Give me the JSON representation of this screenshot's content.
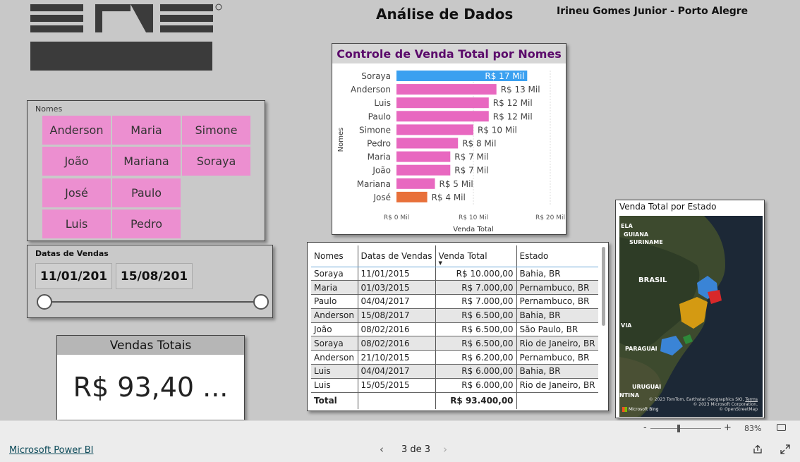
{
  "header": {
    "title": "Análise de Dados",
    "author": "Irineu Gomes Junior - Porto Alegre"
  },
  "names_slicer": {
    "label": "Nomes",
    "items": [
      "Anderson",
      "Maria",
      "Simone",
      "João",
      "Mariana",
      "Soraya",
      "José",
      "Paulo",
      "Luis",
      "Pedro"
    ]
  },
  "date_slicer": {
    "label": "Datas de Vendas",
    "start": "11/01/201",
    "end": "15/08/201"
  },
  "kpi": {
    "title": "Vendas Totais",
    "value": "R$ 93,40 ..."
  },
  "chart_data": {
    "type": "bar",
    "title": "Controle de Venda Total por Nomes",
    "xlabel": "Venda Total",
    "ylabel": "Nomes",
    "categories": [
      "Soraya",
      "Anderson",
      "Luis",
      "Paulo",
      "Simone",
      "Pedro",
      "Maria",
      "João",
      "Mariana",
      "José"
    ],
    "values": [
      17,
      13,
      12,
      12,
      10,
      8,
      7,
      7,
      5,
      4
    ],
    "data_labels": [
      "R$ 17 Mil",
      "R$ 13 Mil",
      "R$ 12 Mil",
      "R$ 12 Mil",
      "R$ 10 Mil",
      "R$ 8 Mil",
      "R$ 7 Mil",
      "R$ 7 Mil",
      "R$ 5 Mil",
      "R$ 4 Mil"
    ],
    "xticks": [
      "R$ 0 Mil",
      "R$ 10 Mil",
      "R$ 20 Mil"
    ],
    "xlim": [
      0,
      20
    ],
    "colors": {
      "default": "#e868c0",
      "highest": "#3aa0f0",
      "lowest": "#e8703a"
    }
  },
  "table": {
    "columns": [
      "Nomes",
      "Datas de Vendas",
      "Venda Total",
      "Estado"
    ],
    "rows": [
      [
        "Soraya",
        "11/01/2015",
        "R$ 10.000,00",
        "Bahia, BR"
      ],
      [
        "Maria",
        "01/03/2015",
        "R$ 7.000,00",
        "Pernambuco, BR"
      ],
      [
        "Paulo",
        "04/04/2017",
        "R$ 7.000,00",
        "Pernambuco, BR"
      ],
      [
        "Anderson",
        "15/08/2017",
        "R$ 6.500,00",
        "Bahia, BR"
      ],
      [
        "João",
        "08/02/2016",
        "R$ 6.500,00",
        "São Paulo, BR"
      ],
      [
        "Soraya",
        "08/02/2016",
        "R$ 6.500,00",
        "Rio de Janeiro, BR"
      ],
      [
        "Anderson",
        "21/10/2015",
        "R$ 6.200,00",
        "Pernambuco, BR"
      ],
      [
        "Luis",
        "04/04/2017",
        "R$ 6.000,00",
        "Bahia, BR"
      ],
      [
        "Luis",
        "15/05/2015",
        "R$ 6.000,00",
        "Rio de Janeiro, BR"
      ]
    ],
    "total_label": "Total",
    "total_value": "R$ 93.400,00"
  },
  "map": {
    "title": "Venda Total por Estado",
    "labels": [
      "GUIANA",
      "SURINAME",
      "BRASIL",
      "VIA",
      "PARAGUAI",
      "URUGUAI",
      "NTINA",
      "ELA"
    ],
    "attribution": [
      "© 2023 TomTom, Earthstar Geographics SIO,",
      "© 2023 Microsoft Corporation,",
      "© OpenStreetMap"
    ],
    "terms": "Terms",
    "bing": "Microsoft Bing"
  },
  "zoom": {
    "percent": "83%"
  },
  "footer": {
    "brand": "Microsoft Power BI",
    "page": "3 de 3"
  }
}
